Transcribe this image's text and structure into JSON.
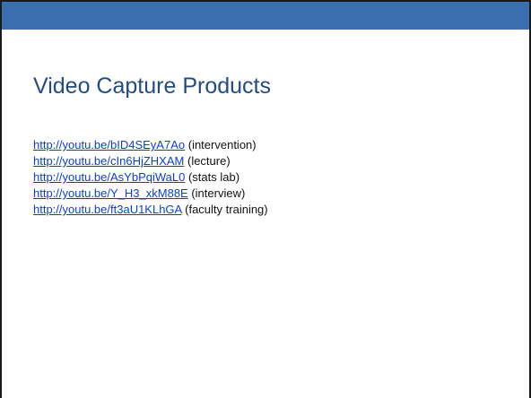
{
  "slide": {
    "title": "Video Capture Products",
    "links": [
      {
        "url": "http://youtu.be/bID4SEyA7Ao",
        "note": "(intervention)"
      },
      {
        "url": "http://youtu.be/cIn6HjZHXAM",
        "note": "(lecture)"
      },
      {
        "url": "http://youtu.be/AsYbPqiWaL0",
        "note": "(stats lab)"
      },
      {
        "url": "http://youtu.be/Y_H3_xkM88E",
        "note": "(interview)"
      },
      {
        "url": "http://youtu.be/ft3aU1KLhGA",
        "note": "(faculty training)"
      }
    ]
  },
  "colors": {
    "header_band": "#3a6fae",
    "title": "#234d80",
    "link": "#0b3fd1"
  }
}
